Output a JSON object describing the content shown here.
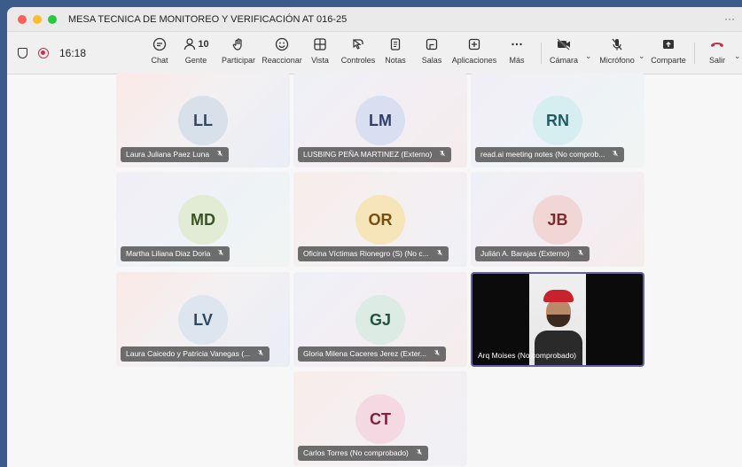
{
  "window": {
    "title": "MESA TECNICA DE MONITOREO Y VERIFICACIÓN AT 016-25",
    "more": "···"
  },
  "toolbar": {
    "timer": "16:18",
    "people_count": "10",
    "buttons": {
      "chat": "Chat",
      "gente": "Gente",
      "participar": "Participar",
      "reaccionar": "Reaccionar",
      "vista": "Vista",
      "controles": "Controles",
      "notas": "Notas",
      "salas": "Salas",
      "aplicaciones": "Aplicaciones",
      "mas": "Más",
      "camara": "Cámara",
      "microfono": "Micrófono",
      "compartir": "Comparte",
      "salir": "Salir"
    }
  },
  "participants": [
    {
      "initials": "LL",
      "name": "Laura Juliana Paez Luna",
      "avatar_bg": "#d8e0ea",
      "avatar_fg": "#2e4a63"
    },
    {
      "initials": "LM",
      "name": "LUSBING PEÑA MARTINEZ (Externo)",
      "avatar_bg": "#d8dff0",
      "avatar_fg": "#2e3f6e"
    },
    {
      "initials": "RN",
      "name": "read.ai meeting notes (No comprob...",
      "avatar_bg": "#d6eef0",
      "avatar_fg": "#1f5d66"
    },
    {
      "initials": "MD",
      "name": "Martha Liliana Diaz Doria",
      "avatar_bg": "#e2ecd4",
      "avatar_fg": "#3b5424"
    },
    {
      "initials": "OR",
      "name": "Oficina Víctimas Rionegro (S) (No c...",
      "avatar_bg": "#f6e5b8",
      "avatar_fg": "#7a4f0d"
    },
    {
      "initials": "JB",
      "name": "Julián A. Barajas (Externo)",
      "avatar_bg": "#f1d6d6",
      "avatar_fg": "#7e2a2a"
    },
    {
      "initials": "LV",
      "name": "Laura Caicedo y Patricia Vanegas (...",
      "avatar_bg": "#dde5ee",
      "avatar_fg": "#2e4a63"
    },
    {
      "initials": "GJ",
      "name": "Gloria Milena Caceres Jerez (Exter...",
      "avatar_bg": "#dcebe3",
      "avatar_fg": "#245240"
    },
    {
      "initials": "CT",
      "name": "Carlos Torres (No comprobado)",
      "avatar_bg": "#f4d9e2",
      "avatar_fg": "#7a2340"
    }
  ],
  "video_participant": {
    "name": "Arq Moises (No comprobado)"
  }
}
